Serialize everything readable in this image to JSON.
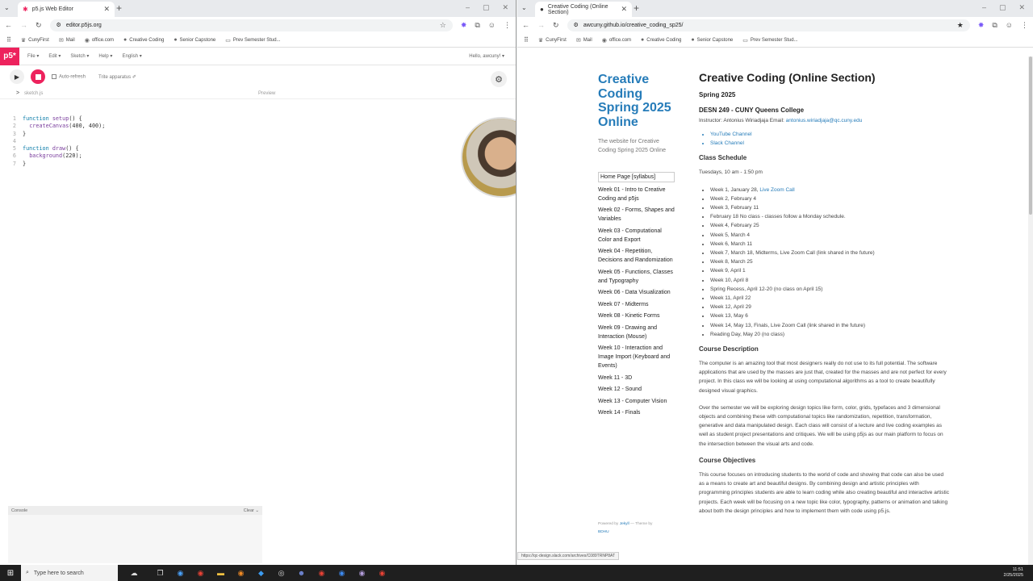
{
  "left_browser": {
    "tab_title": "p5.js Web Editor",
    "url": "editor.p5js.org",
    "bookmarks": [
      "CunyFirst",
      "Mail",
      "office.com",
      "Creative Coding",
      "Senior Capstone",
      "Prev Semester Stud..."
    ]
  },
  "right_browser": {
    "tab_title": "Creative Coding (Online Section)",
    "url": "awcuny.github.io/creative_coding_sp25/",
    "bookmarks": [
      "CunyFirst",
      "Mail",
      "office.com",
      "Creative Coding",
      "Senior Capstone",
      "Prev Semester Stud..."
    ],
    "status_url": "https://qc-design.slack.com/archives/C089TRNP8AT"
  },
  "p5editor": {
    "logo": "p5*",
    "menu": [
      "File ▾",
      "Edit ▾",
      "Sketch ▾",
      "Help ▾",
      "English ▾"
    ],
    "user": "Hello, awcuny! ▾",
    "auto_refresh": "Auto-refresh",
    "sketch_name": "Trite apparatus ✐",
    "file_name": "sketch.js",
    "preview_label": "Preview",
    "console_label": "Console",
    "clear_label": "Clear ⌄",
    "code_lines": [
      {
        "n": "1",
        "text": "function setup() {"
      },
      {
        "n": "2",
        "text": "  createCanvas(400, 400);"
      },
      {
        "n": "3",
        "text": "}"
      },
      {
        "n": "4",
        "text": ""
      },
      {
        "n": "5",
        "text": "function draw() {"
      },
      {
        "n": "6",
        "text": "  background(220);"
      },
      {
        "n": "7",
        "text": "}"
      }
    ]
  },
  "site": {
    "title": "Creative Coding Spring 2025 Online",
    "description": "The website for Creative Coding Spring 2025 Online",
    "nav": [
      "Home Page [syllabus]",
      "Week 01 - Intro to Creative Coding and p5js",
      "Week 02 - Forms, Shapes and Variables",
      "Week 03 - Computational Color and Export",
      "Week 04 - Repetition, Decisions and Randomization",
      "Week 05 - Functions, Classes and Typography",
      "Week 06 - Data Visualization",
      "Week 07 - Midterms",
      "Week 08 - Kinetic Forms",
      "Week 09 - Drawing and Interaction (Mouse)",
      "Week 10 - Interaction and Image Import (Keyboard and Events)",
      "Week 11 - 3D",
      "Week 12 - Sound",
      "Week 13 - Computer Vision",
      "Week 14 - Finals"
    ],
    "theme_prefix": "Powered by",
    "theme_link1": "Jekyll",
    "theme_mid": "— Theme by",
    "theme_link2": "BDHU",
    "heading": "Creative Coding (Online Section)",
    "semester": "Spring 2025",
    "course": "DESN 249 - CUNY Queens College",
    "instructor": "Instructor: Antonius Wiriadjaja Email:",
    "email": "antonius.wiriadjaja@qc.cuny.edu",
    "links": [
      "YouTube Channel",
      "Slack Channel"
    ],
    "schedule_heading": "Class Schedule",
    "schedule_time": "Tuesdays, 10 am - 1:50 pm",
    "week1": "Week 1, January 28,",
    "week1_link": "Live Zoom Call",
    "schedule": [
      "Week 2, February 4",
      "Week 3, February 11",
      "February 18 No class - classes follow a Monday schedule.",
      "Week 4, February 25",
      "Week 5, March 4",
      "Week 6, March 11",
      "Week 7, March 18, Midterms, Live Zoom Call (link shared in the future)",
      "Week 8, March 25",
      "Week 9, April 1",
      "Week 10, April 8",
      "Spring Recess, April 12-20 (no class on April 15)",
      "Week 11, April 22",
      "Week 12, April 29",
      "Week 13, May 6",
      "Week 14, May 13, Finals, Live Zoom Call (link shared in the future)",
      "Reading Day, May 20 (no class)"
    ],
    "desc_heading": "Course Description",
    "desc_p1": "The computer is an amazing tool that most designers really do not use to its full potential. The software applications that are used by the masses are just that, created for the masses and are not perfect for every project. In this class we will be looking at using computational algorithms as a tool to create beautifully designed visual graphics.",
    "desc_p2": "Over the semester we will be exploring design topics like form, color, grids, typefaces and 3 dimensional objects and combining these with computational topics like randomization, repetition, transformation, generative and data manipulated design. Each class will consist of a lecture and live coding examples as well as student project presentations and critiques. We will be using p5js as our main platform to focus on the intersection between the visual arts and code.",
    "obj_heading": "Course Objectives",
    "obj_p1": "This course focuses on introducing students to the world of code and showing that code can also be used as a means to create art and beautiful designs. By combining design and artistic principles with programming principles students are able to learn coding while also creating beautiful and interactive artistic projects. Each week will be focusing on a new topic like color, typography, patterns or animation and talking about both the design principles and how to implement them with code using p5.js."
  },
  "taskbar": {
    "search_placeholder": "Type here to search",
    "time": "11:51",
    "date": "2/25/2025"
  }
}
